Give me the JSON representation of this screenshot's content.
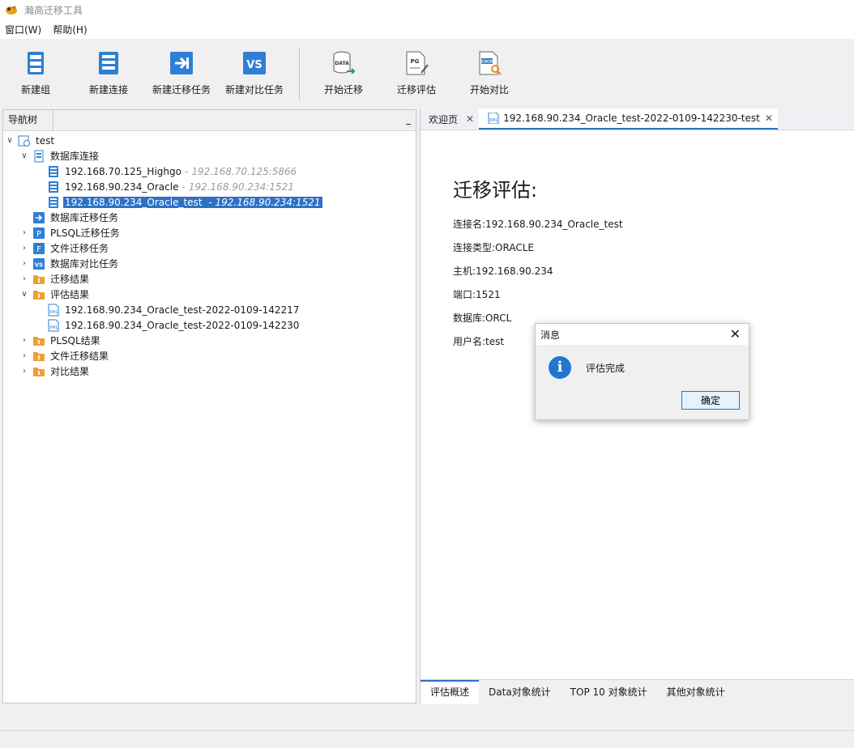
{
  "app": {
    "title": "瀚高迁移工具"
  },
  "menu": {
    "items": [
      "窗口(W)",
      "帮助(H)"
    ]
  },
  "toolbar": {
    "new_group": "新建组",
    "new_connection": "新建连接",
    "new_migration_task": "新建迁移任务",
    "new_compare_task": "新建对比任务",
    "start_migration": "开始迁移",
    "migration_assess": "迁移评估",
    "start_compare": "开始对比"
  },
  "nav": {
    "title": "导航树",
    "minimize": "_",
    "root": "test",
    "db_connections": "数据库连接",
    "connections": [
      {
        "name": "192.168.70.125_Highgo",
        "addr": "192.168.70.125:5866"
      },
      {
        "name": "192.168.90.234_Oracle",
        "addr": "192.168.90.234:1521"
      },
      {
        "name": "192.168.90.234_Oracle_test",
        "addr": "192.168.90.234:1521"
      }
    ],
    "db_migration_tasks": "数据库迁移任务",
    "plsql_tasks": "PLSQL迁移任务",
    "file_tasks": "文件迁移任务",
    "compare_tasks": "数据库对比任务",
    "migration_results": "迁移结果",
    "assess_results": "评估结果",
    "assess_items": [
      "192.168.90.234_Oracle_test-2022-0109-142217",
      "192.168.90.234_Oracle_test-2022-0109-142230"
    ],
    "plsql_results": "PLSQL结果",
    "file_results": "文件迁移结果",
    "compare_results": "对比结果"
  },
  "editor": {
    "tabs": [
      "欢迎页",
      "192.168.90.234_Oracle_test-2022-0109-142230-test"
    ],
    "heading": "迁移评估:",
    "fields": {
      "conn_name": "连接名:192.168.90.234_Oracle_test",
      "conn_type": "连接类型:ORACLE",
      "host": "主机:192.168.90.234",
      "port": "端口:1521",
      "database": "数据库:ORCL",
      "user": "用户名:test"
    },
    "bottom_tabs": [
      "评估概述",
      "Data对象统计",
      "TOP 10 对象统计",
      "其他对象统计"
    ]
  },
  "dialog": {
    "title": "消息",
    "message": "评估完成",
    "ok": "确定",
    "close": "✕"
  },
  "colors": {
    "accent": "#2d71c4",
    "icon_blue": "#1f77d0",
    "folder_orange": "#f0a030"
  }
}
